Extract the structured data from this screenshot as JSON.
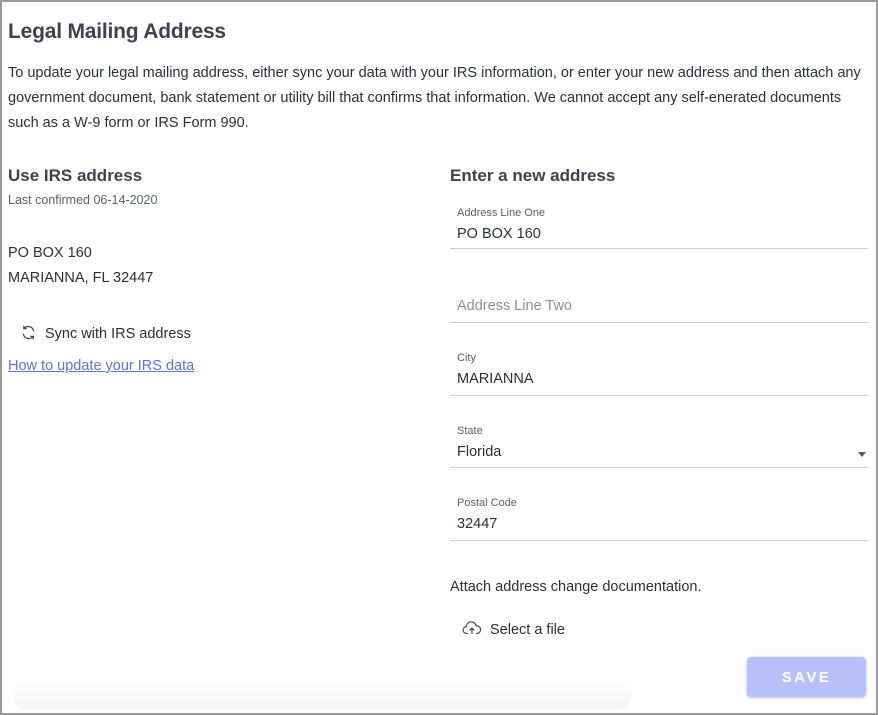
{
  "page": {
    "title": "Legal Mailing Address",
    "intro": "To update your legal mailing address, either sync your data with your IRS information, or enter your new address and then attach any government document, bank statement or utility bill that confirms that information. We cannot accept any self-enerated documents such as a W-9 form or IRS Form 990."
  },
  "irs": {
    "heading": "Use IRS address",
    "last_confirmed": "Last confirmed 06-14-2020",
    "address_line1": "PO BOX 160",
    "address_line2": "MARIANNA, FL 32447",
    "sync_label": "Sync with IRS address",
    "help_link": "How to update your IRS data"
  },
  "new_address": {
    "heading": "Enter a new address",
    "line_one": {
      "label": "Address Line One",
      "value": "PO BOX 160"
    },
    "line_two": {
      "placeholder": "Address Line Two",
      "value": ""
    },
    "city": {
      "label": "City",
      "value": "MARIANNA"
    },
    "state": {
      "label": "State",
      "value": "Florida"
    },
    "postal": {
      "label": "Postal Code",
      "value": "32447"
    },
    "attach_label": "Attach address change documentation.",
    "select_file": "Select a file"
  },
  "actions": {
    "save": "SAVE"
  },
  "colors": {
    "link": "#5a74d8",
    "save_button": "#b7c0f8",
    "heading": "#3d4152"
  },
  "icons": {
    "sync": "sync-icon",
    "upload": "cloud-upload-icon",
    "dropdown": "chevron-down-icon"
  }
}
